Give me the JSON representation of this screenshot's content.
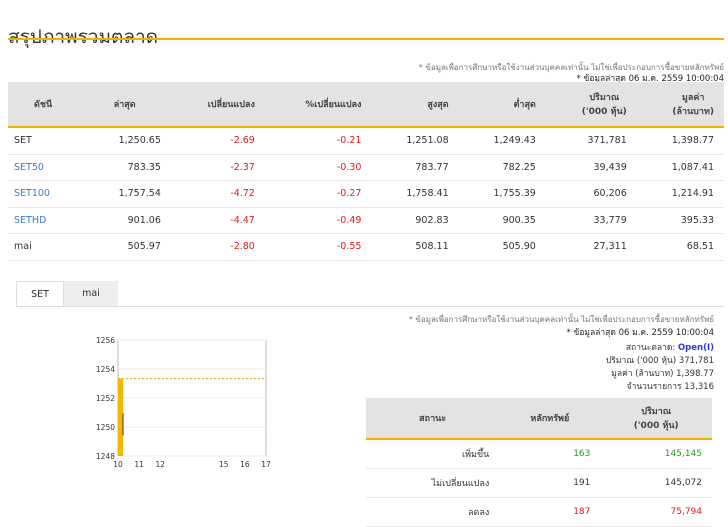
{
  "page_title": "สรุปภาพรวมตลาด",
  "disclaimer": "* ข้อมูลเพื่อการศึกษาหรือใช้งานส่วนบุคคลเท่านั้น ไม่ใช่เพื่อประกอบการซื้อขายหลักทรัพย์",
  "last_update": "* ข้อมูลล่าสุด 06 ม.ค. 2559 10:00:04",
  "index_table": {
    "headers": [
      "ดัชนี",
      "ล่าสุด",
      "เปลี่ยนแปลง",
      "%เปลี่ยนแปลง",
      "สูงสุด",
      "ต่ำสุด",
      "ปริมาณ\n('000 หุ้น)",
      "มูลค่า\n(ล้านบาท)"
    ],
    "rows": [
      {
        "name": "SET",
        "last": "1,250.65",
        "change": "-2.69",
        "pct": "-0.21",
        "high": "1,251.08",
        "low": "1,249.43",
        "volume": "371,781",
        "value": "1,398.77"
      },
      {
        "name": "SET50",
        "last": "783.35",
        "change": "-2.37",
        "pct": "-0.30",
        "high": "783.77",
        "low": "782.25",
        "volume": "39,439",
        "value": "1,087.41"
      },
      {
        "name": "SET100",
        "last": "1,757.54",
        "change": "-4.72",
        "pct": "-0.27",
        "high": "1,758.41",
        "low": "1,755.39",
        "volume": "60,206",
        "value": "1,214.91"
      },
      {
        "name": "SETHD",
        "last": "901.06",
        "change": "-4.47",
        "pct": "-0.49",
        "high": "902.83",
        "low": "900.35",
        "volume": "33,779",
        "value": "395.33"
      },
      {
        "name": "mai",
        "last": "505.97",
        "change": "-2.80",
        "pct": "-0.55",
        "high": "508.11",
        "low": "505.90",
        "volume": "27,311",
        "value": "68.51"
      }
    ]
  },
  "tabs": [
    {
      "label": "SET"
    },
    {
      "label": "mai"
    }
  ],
  "market_stats": {
    "status_label": "สถานะตลาด:",
    "status_value": "Open(I)",
    "volume_label": "ปริมาณ ('000 หุ้น)",
    "volume_value": "371,781",
    "value_label": "มูลค่า (ล้านบาท)",
    "value_value": "1,398.77",
    "trades_label": "จำนวนรายการ",
    "trades_value": "13,316"
  },
  "summary_table": {
    "headers": [
      "สถานะ",
      "หลักทรัพย์",
      "ปริมาณ\n('000 หุ้น)"
    ],
    "rows": [
      {
        "status": "เพิ่มขึ้น",
        "count": "163",
        "volume": "145,145"
      },
      {
        "status": "ไม่เปลี่ยนแปลง",
        "count": "191",
        "volume": "145,072"
      },
      {
        "status": "ลดลง",
        "count": "187",
        "volume": "75,794"
      }
    ]
  },
  "colors": {
    "accent": "#f0b400",
    "negative": "#d8201f",
    "positive": "#2a9a2a",
    "link": "#3d7cc9"
  },
  "chart_data": {
    "type": "bar",
    "x_ticks": [
      "10",
      "11",
      "12",
      "15",
      "16",
      "17"
    ],
    "y_ticks": [
      "1256",
      "1254",
      "1252",
      "1250",
      "1248"
    ],
    "ylim": [
      1248,
      1256
    ],
    "reference_line": 1253.34,
    "bars": [
      {
        "x": 10,
        "open": 1253.34,
        "close": 1250.65,
        "high": 1251.08,
        "low": 1249.43
      }
    ]
  }
}
